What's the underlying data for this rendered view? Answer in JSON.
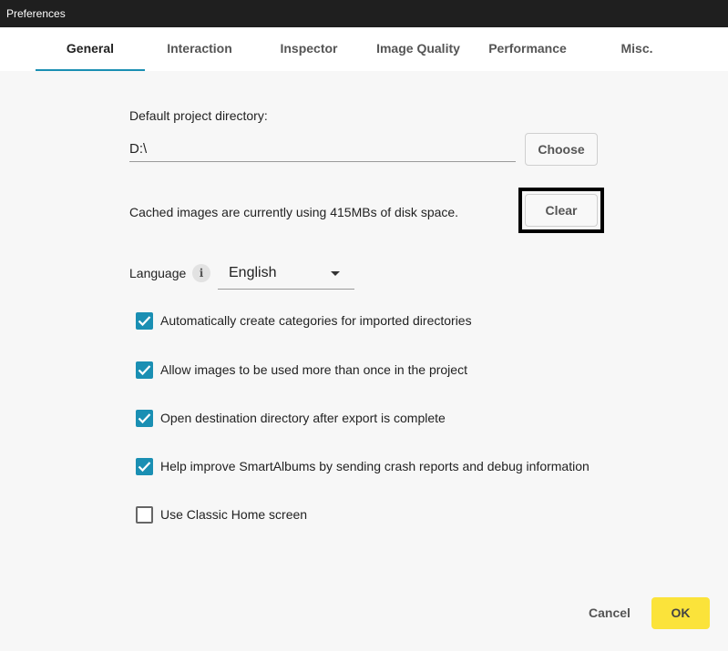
{
  "window": {
    "title": "Preferences"
  },
  "tabs": [
    {
      "label": "General"
    },
    {
      "label": "Interaction"
    },
    {
      "label": "Inspector"
    },
    {
      "label": "Image Quality"
    },
    {
      "label": "Performance"
    },
    {
      "label": "Misc."
    }
  ],
  "active_tab": "General",
  "project_dir": {
    "label": "Default project directory:",
    "value": "D:\\",
    "choose_label": "Choose"
  },
  "cache": {
    "text": "Cached images are currently using 415MBs of disk space.",
    "clear_label": "Clear"
  },
  "language": {
    "label": "Language",
    "info_glyph": "i",
    "selected": "English"
  },
  "options": [
    {
      "label": "Automatically create categories for imported directories",
      "checked": true
    },
    {
      "label": "Allow images to be used more than once in the project",
      "checked": true
    },
    {
      "label": "Open destination directory after export is complete",
      "checked": true
    },
    {
      "label": "Help improve SmartAlbums by sending crash reports and debug information",
      "checked": true
    },
    {
      "label": "Use Classic Home screen",
      "checked": false
    }
  ],
  "footer": {
    "cancel_label": "Cancel",
    "ok_label": "OK"
  },
  "colors": {
    "accent": "#1a8fb3",
    "ok_button": "#fbe33a",
    "titlebar": "#1f1f1f"
  },
  "icons": {
    "info": "info-icon",
    "dropdown": "chevron-down-icon",
    "check": "checkmark-icon"
  }
}
